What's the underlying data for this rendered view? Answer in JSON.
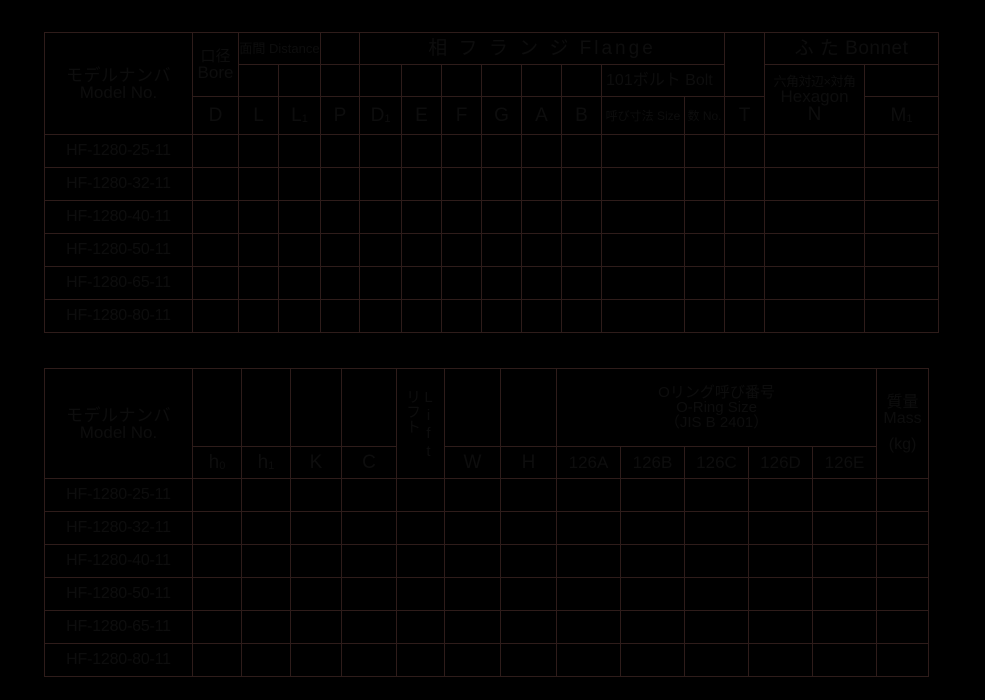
{
  "table1": {
    "model_header": {
      "jp": "モデルナンバ",
      "en": "Model No."
    },
    "bore": {
      "jp": "口径",
      "en": "Bore",
      "symbol": "D"
    },
    "distance": {
      "label": "面間 Distance",
      "symbols": [
        "L",
        "L1"
      ]
    },
    "p_symbol": "P",
    "flange": {
      "title": "相 フ ラ ン ジ Flange",
      "symbols": [
        "D1",
        "E",
        "F",
        "G",
        "A",
        "B"
      ],
      "bolt": {
        "label": "101ボルト Bolt",
        "size_label": "呼び寸法 Size",
        "no_label": "数 No."
      }
    },
    "t_symbol": "T",
    "bonnet": {
      "title": "ふ た Bonnet",
      "hexagon": {
        "jp": "六角対辺×対角",
        "en": "Hexagon",
        "symbol": "N"
      },
      "m1_symbol": "M1"
    },
    "rows": [
      "HF-1280-25-11",
      "HF-1280-32-11",
      "HF-1280-40-11",
      "HF-1280-50-11",
      "HF-1280-65-11",
      "HF-1280-80-11"
    ]
  },
  "table2": {
    "model_header": {
      "jp": "モデルナンバ",
      "en": "Model No."
    },
    "symbols": [
      "h0",
      "h1",
      "K",
      "C"
    ],
    "lift": {
      "jp": "リフト",
      "en": "Lift"
    },
    "w_symbol": "W",
    "h_symbol": "H",
    "oring": {
      "line1": "Oリング呼び番号",
      "line2": "O-Ring Size",
      "line3": "（JIS B 2401）",
      "sizes": [
        "126A",
        "126B",
        "126C",
        "126D",
        "126E"
      ]
    },
    "mass": {
      "jp": "質量",
      "en": "Mass",
      "unit": "(kg)"
    },
    "rows": [
      "HF-1280-25-11",
      "HF-1280-32-11",
      "HF-1280-40-11",
      "HF-1280-50-11",
      "HF-1280-65-11",
      "HF-1280-80-11"
    ]
  },
  "colors": {
    "header_green": "#22b26e",
    "background": "#000000",
    "gridline": "#2e1c1a"
  }
}
